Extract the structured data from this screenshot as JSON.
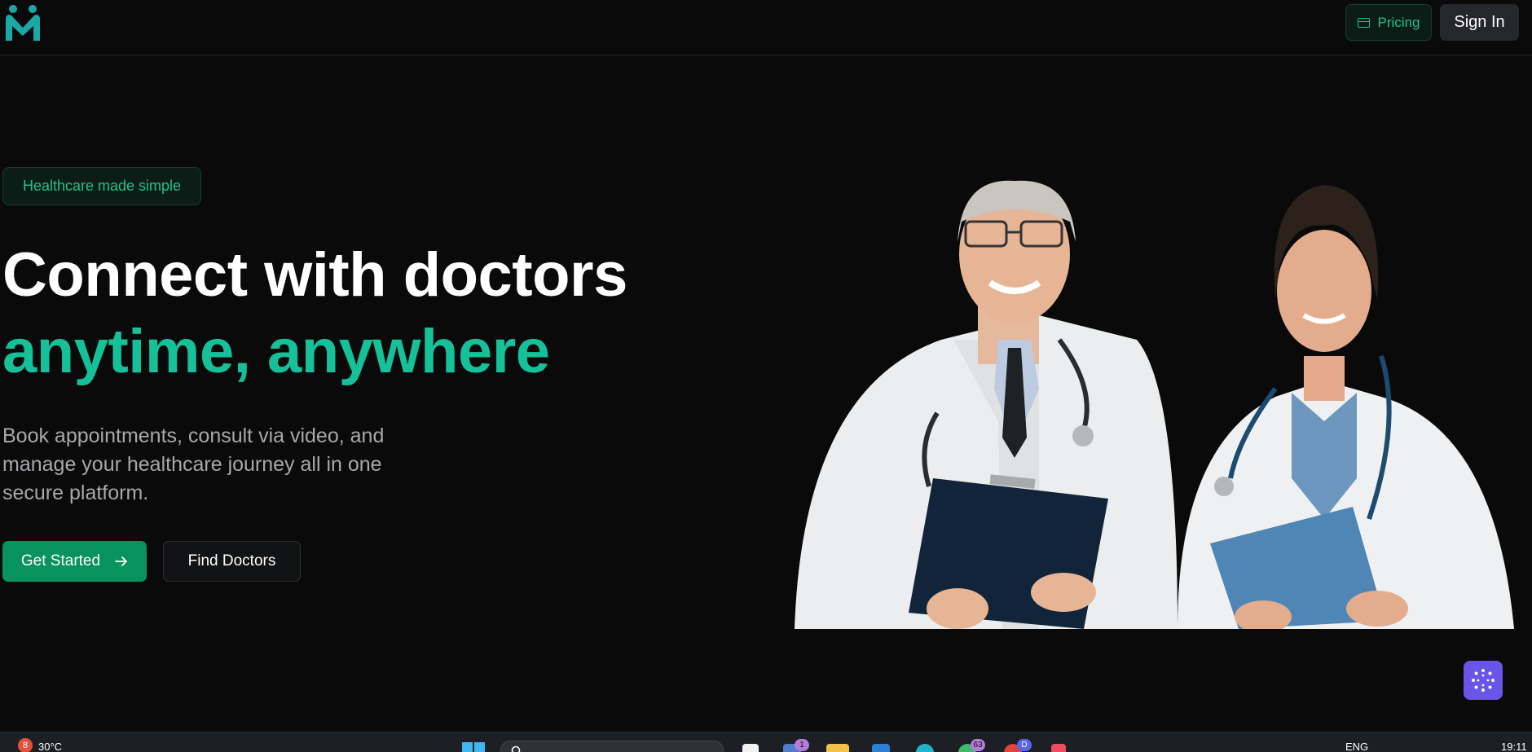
{
  "header": {
    "logo_name": "app-logo",
    "pricing_label": "Pricing",
    "signin_label": "Sign In"
  },
  "hero": {
    "badge": "Healthcare made simple",
    "title_line1": "Connect with doctors",
    "title_line2": "anytime, anywhere",
    "subtitle": "Book appointments, consult via video, and manage your healthcare journey all in one secure platform.",
    "cta_primary": "Get Started",
    "cta_secondary": "Find Doctors",
    "image_icon": "doctors-photo"
  },
  "taskbar": {
    "weather_badge": "8",
    "weather": "30°C",
    "badge_calendar": "1",
    "badge_chat": "63",
    "badge_discord": "D",
    "language": "ENG",
    "time": "19:11"
  },
  "colors": {
    "background": "#0a0a0a",
    "accent": "#16c19a",
    "primary_button": "#07925e",
    "assistant": "#6a55e8"
  }
}
